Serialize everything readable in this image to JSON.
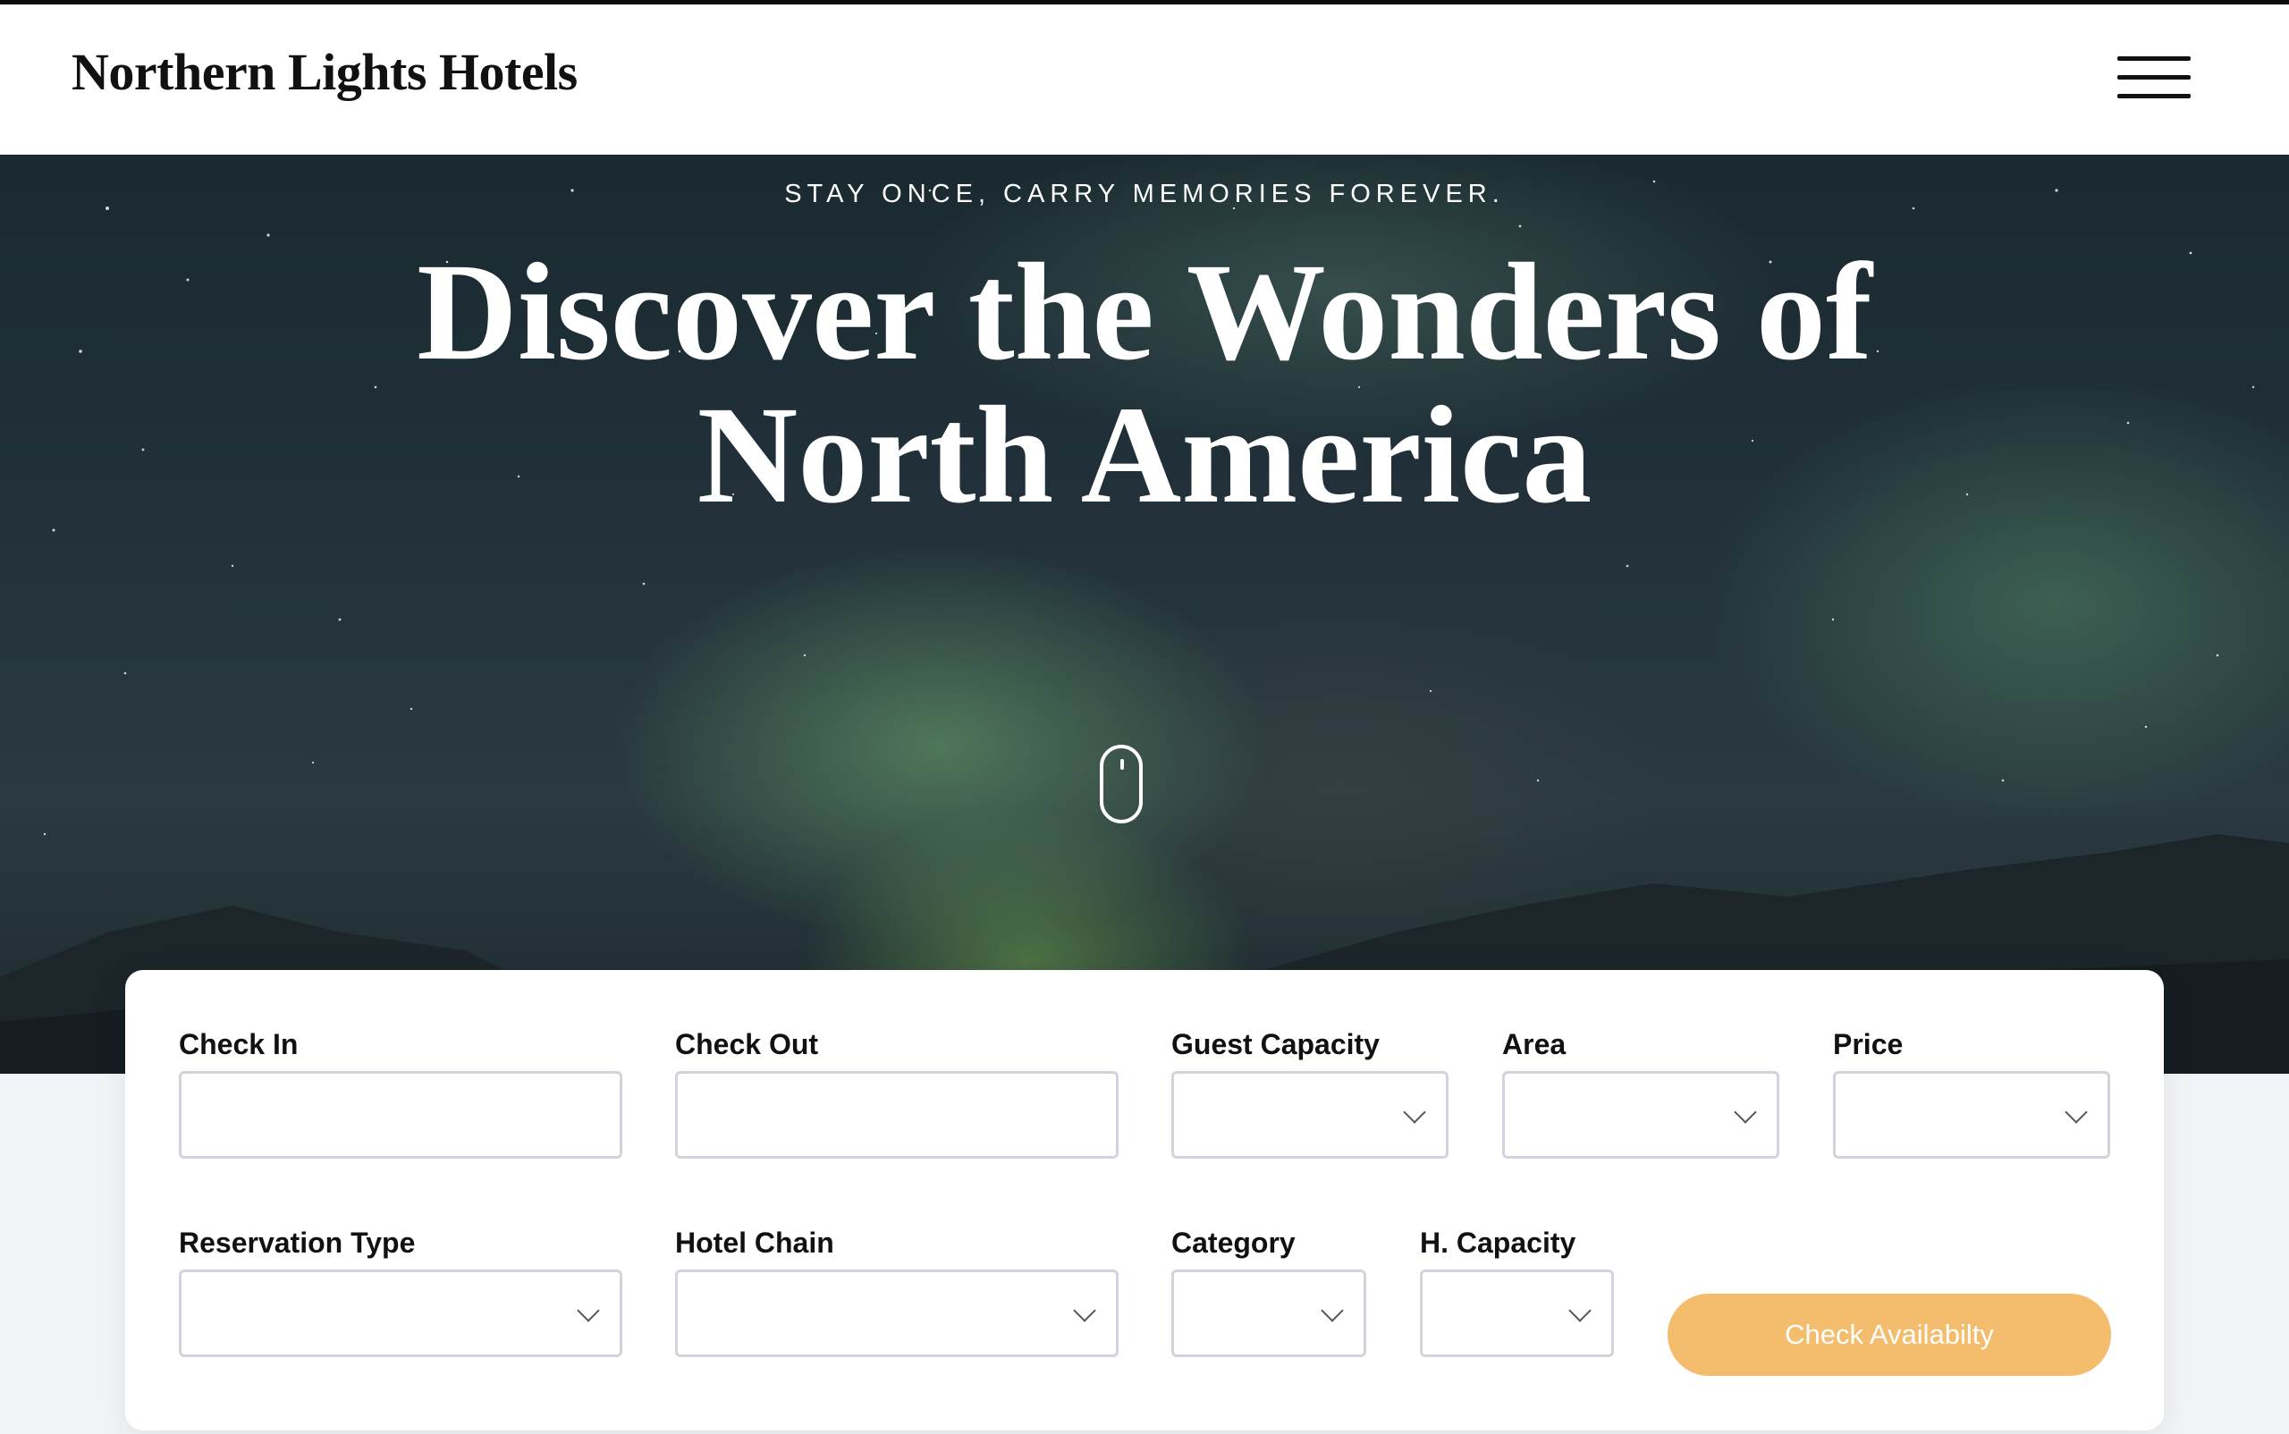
{
  "header": {
    "brand": "Northern Lights Hotels",
    "menu_icon": "hamburger-menu-icon"
  },
  "hero": {
    "tagline": "STAY ONCE, CARRY MEMORIES FOREVER.",
    "headline_line1": "Discover the Wonders of",
    "headline_line2": "North America",
    "scroll_icon": "mouse-scroll-icon"
  },
  "search": {
    "fields": {
      "check_in": {
        "label": "Check In",
        "value": ""
      },
      "check_out": {
        "label": "Check Out",
        "value": ""
      },
      "guest_capacity": {
        "label": "Guest Capacity",
        "value": ""
      },
      "area": {
        "label": "Area",
        "value": ""
      },
      "price": {
        "label": "Price",
        "value": ""
      },
      "reservation_type": {
        "label": "Reservation Type",
        "value": ""
      },
      "hotel_chain": {
        "label": "Hotel Chain",
        "value": ""
      },
      "category": {
        "label": "Category",
        "value": ""
      },
      "h_capacity": {
        "label": "H. Capacity",
        "value": ""
      }
    },
    "submit_label": "Check Availabilty"
  },
  "colors": {
    "accent": "#f4bd6d",
    "field_border": "#d1d4dc",
    "text": "#111111"
  }
}
